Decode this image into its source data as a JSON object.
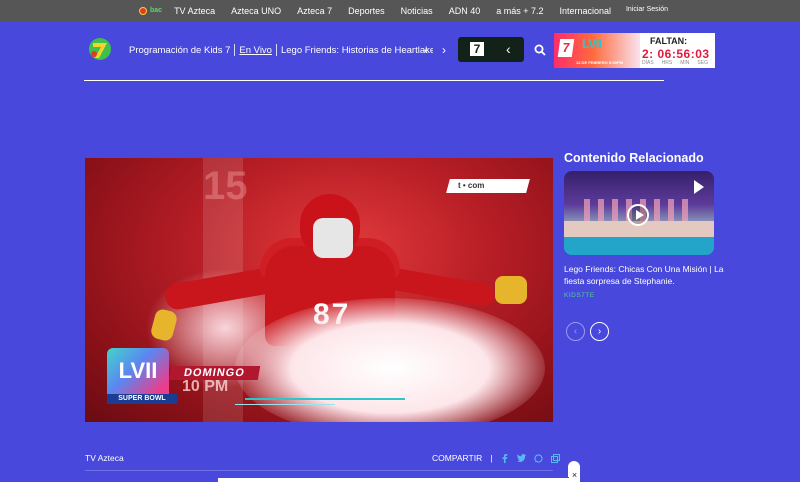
{
  "topbar": {
    "brand_text": "bac",
    "items": [
      "TV Azteca",
      "Azteca UNO",
      "Azteca 7",
      "Deportes",
      "Noticias",
      "ADN 40",
      "a más + 7.2",
      "Internacional"
    ],
    "login": "Iniciar Sesión"
  },
  "header": {
    "nav_program": "Programación de Kids 7",
    "nav_live": "En Vivo",
    "nav_show": "Lego Friends: Historias de Heartlake C",
    "prev_arrow": "‹",
    "next_arrow": "›",
    "channel_label": "7",
    "channel_chevron": "‹",
    "icon_search": "search-icon"
  },
  "countdown": {
    "brand": "7",
    "event": "LVII",
    "date_text": "12 DE FEBRERO 5:00PM",
    "label": "FALTAN:",
    "time": "2: 06:56:03",
    "units": [
      "DÍAS",
      "HRS",
      "MIN",
      "SEG"
    ]
  },
  "video": {
    "watermark": "t • com",
    "headline": "DOMINGO",
    "time_text": "10 PM",
    "logo_text": "LVII",
    "logo_sub": "SUPER BOWL",
    "jersey_number": "87"
  },
  "footer": {
    "source": "TV Azteca",
    "share_label": "COMPARTIR",
    "share_sep": "|",
    "close": "×"
  },
  "related": {
    "title": "Contenido Relacionado",
    "item_title": "Lego Friends: Chicas Con Una Misión | La fiesta sorpresa de Stephanie.",
    "item_tag": "KIDS7TE",
    "prev": "‹",
    "next": "›"
  },
  "colors": {
    "background": "#4848dc",
    "topbar": "#565656",
    "accent_green": "#4fd38a",
    "countdown_red": "#e3193d"
  }
}
